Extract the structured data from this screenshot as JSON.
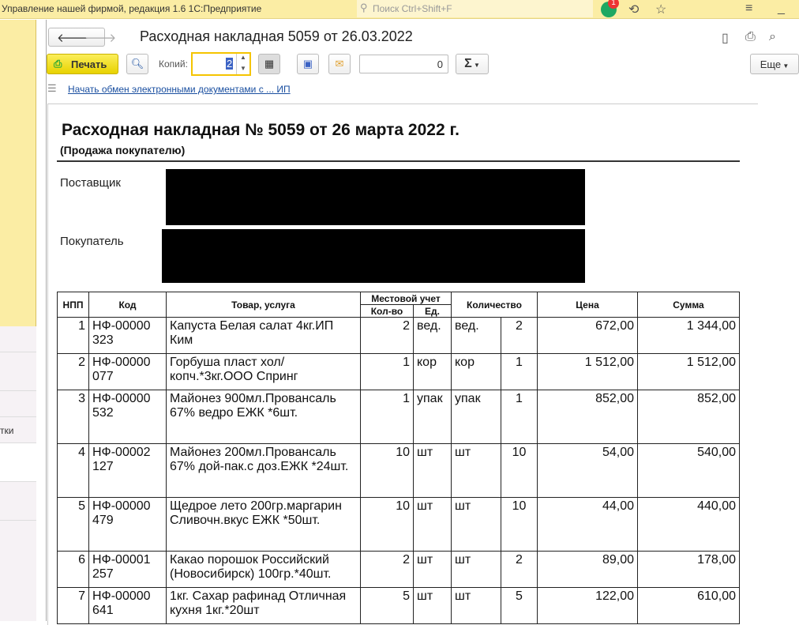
{
  "app": {
    "title": "Управление нашей фирмой, редакция 1.6 1С:Предприятие",
    "search_placeholder": "Поиск Ctrl+Shift+F",
    "notifications": "1"
  },
  "left_panel": {
    "partial_item": "тки"
  },
  "form": {
    "title": "Расходная накладная 5059 от 26.03.2022",
    "print_label": "Печать",
    "copies_label": "Копий:",
    "copies_value": "2",
    "number_value": "0",
    "sum_label": "Σ",
    "more_label": "Еще",
    "edo_link": "Начать обмен электронными документами с ... ИП"
  },
  "document": {
    "title": "Расходная накладная № 5059 от 26 марта 2022 г.",
    "subtitle": "(Продажа покупателю)",
    "supplier_label": "Поставщик",
    "buyer_label": "Покупатель",
    "headers": {
      "npp": "НПП",
      "code": "Код",
      "product": "Товар, услуга",
      "local": "Местовой учет",
      "qty_local": "Кол-во",
      "unit_local": "Ед.",
      "quantity": "Количество",
      "price": "Цена",
      "sum": "Сумма"
    },
    "rows": [
      {
        "n": "1",
        "code": "НФ-00000 323",
        "name": "Капуста Белая салат 4кг.ИП Ким",
        "q1": "2",
        "u1": "вед.",
        "u2": "вед.",
        "q2": "2",
        "price": "672,00",
        "sum": "1 344,00"
      },
      {
        "n": "2",
        "code": "НФ-00000 077",
        "name": "Горбуша пласт хол/копч.*3кг.ООО Спринг",
        "q1": "1",
        "u1": "кор",
        "u2": "кор",
        "q2": "1",
        "price": "1 512,00",
        "sum": "1 512,00"
      },
      {
        "n": "3",
        "code": "НФ-00000 532",
        "name": "Майонез 900мл.Провансаль 67% ведро ЕЖК *6шт.",
        "q1": "1",
        "u1": "упак",
        "u2": "упак",
        "q2": "1",
        "price": "852,00",
        "sum": "852,00"
      },
      {
        "n": "4",
        "code": "НФ-00002 127",
        "name": "Майонез 200мл.Провансаль 67% дой-пак.с доз.ЕЖК *24шт.",
        "q1": "10",
        "u1": "шт",
        "u2": "шт",
        "q2": "10",
        "price": "54,00",
        "sum": "540,00"
      },
      {
        "n": "5",
        "code": "НФ-00000 479",
        "name": "Щедрое лето 200гр.маргарин Сливочн.вкус ЕЖК *50шт.",
        "q1": "10",
        "u1": "шт",
        "u2": "шт",
        "q2": "10",
        "price": "44,00",
        "sum": "440,00"
      },
      {
        "n": "6",
        "code": "НФ-00001 257",
        "name": "Какао порошок Российский (Новосибирск) 100гр.*40шт.",
        "q1": "2",
        "u1": "шт",
        "u2": "шт",
        "q2": "2",
        "price": "89,00",
        "sum": "178,00"
      },
      {
        "n": "7",
        "code": "НФ-00000 641",
        "name": "1кг. Сахар рафинад Отличная кухня 1кг.*20шт",
        "q1": "5",
        "u1": "шт",
        "u2": "шт",
        "q2": "5",
        "price": "122,00",
        "sum": "610,00"
      }
    ]
  }
}
